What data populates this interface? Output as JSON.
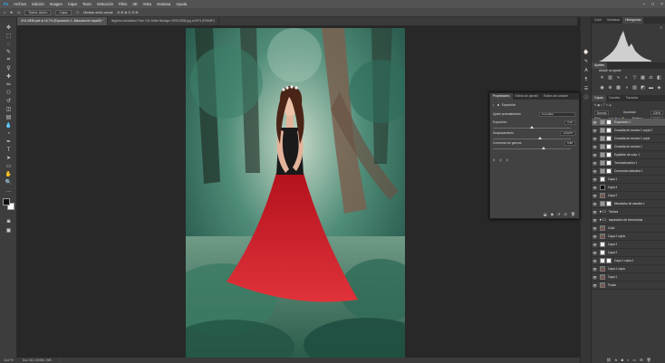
{
  "menu": {
    "items": [
      "Archivo",
      "Edición",
      "Imagen",
      "Capa",
      "Texto",
      "Selección",
      "Filtro",
      "3D",
      "Vista",
      "Ventana",
      "Ayuda"
    ]
  },
  "options": {
    "items": [
      "Tolero: Acriro",
      "Capa:",
      "Mostrar anillo actual"
    ]
  },
  "doc_tabs": {
    "active": "ZHJ-0838.psd al 16,7% (Exposición 1, Máscara de capa/8) *",
    "other": "Ilegitimó fantástica Tinto Cfo White Backgro 2090/3838.jpg al 50% (RGB/8*)"
  },
  "status": {
    "zoom": "16,67%",
    "doc": "Doc: 56,1 M/498,2 MB"
  },
  "panels": {
    "top_tabs": [
      "Color",
      "Muestras",
      "Histograma"
    ],
    "adjust_tabs": [
      "Ajustes"
    ],
    "adjust_title": "Añadir un ajuste",
    "layers_tabs": [
      "Capas",
      "Canales",
      "Trazados"
    ],
    "blend_mode": "Normal",
    "opacity_label": "Opacidad:",
    "opacity_value": "100%",
    "lock_label": "Bloq:",
    "fill_label": "Relleno:",
    "fill_value": "100%"
  },
  "layers": [
    {
      "name": "Exposición 1",
      "type": "adj",
      "mask": true,
      "selected": true
    },
    {
      "name": "Consulta de colores 1 copia 2",
      "type": "adj",
      "mask": true
    },
    {
      "name": "Consulta de colores 1 copia",
      "type": "adj",
      "mask": true
    },
    {
      "name": "Consulta de colores 1",
      "type": "adj",
      "mask": true
    },
    {
      "name": "Equilibrio de color 1",
      "type": "adj",
      "mask": true
    },
    {
      "name": "Tono/saturación 1",
      "type": "adj",
      "mask": true
    },
    {
      "name": "Corrección selectiva 1",
      "type": "adj",
      "mask": true
    },
    {
      "name": "Capa 1",
      "type": "white",
      "mask": false
    },
    {
      "name": "Capa 4",
      "type": "black",
      "mask": false
    },
    {
      "name": "Capa 2",
      "type": "photo",
      "mask": false
    },
    {
      "name": "Mezclador de canales 1",
      "type": "adj",
      "mask": true
    },
    {
      "name": "Textura",
      "type": "folder",
      "mask": false
    },
    {
      "name": "separación de frecuencias",
      "type": "folder",
      "mask": false
    },
    {
      "name": "Color",
      "type": "photo",
      "mask": false
    },
    {
      "name": "Capa 2 copia",
      "type": "photo",
      "mask": false
    },
    {
      "name": "Capa 3",
      "type": "white",
      "mask": false
    },
    {
      "name": "Capa 2",
      "type": "white",
      "mask": false
    },
    {
      "name": "Capa 1 copia 2",
      "type": "white",
      "mask": true
    },
    {
      "name": "Capa 1 copia",
      "type": "photo",
      "mask": false
    },
    {
      "name": "Capa 1",
      "type": "photo",
      "mask": false
    },
    {
      "name": "Fondo",
      "type": "photo",
      "mask": false
    }
  ],
  "properties": {
    "tabs": [
      "Propiedades",
      "Estilos de párrafo",
      "Estilos de carácter"
    ],
    "title": "Exposición",
    "preset_label": "Ajuste preestablecido:",
    "preset_value": "A medida",
    "exposure_label": "Exposición",
    "exposure_value": "0,00",
    "offset_label": "Desplazamiento",
    "offset_value": "+0,0275",
    "gamma_label": "Corrección de gamma",
    "gamma_value": "0,88"
  }
}
